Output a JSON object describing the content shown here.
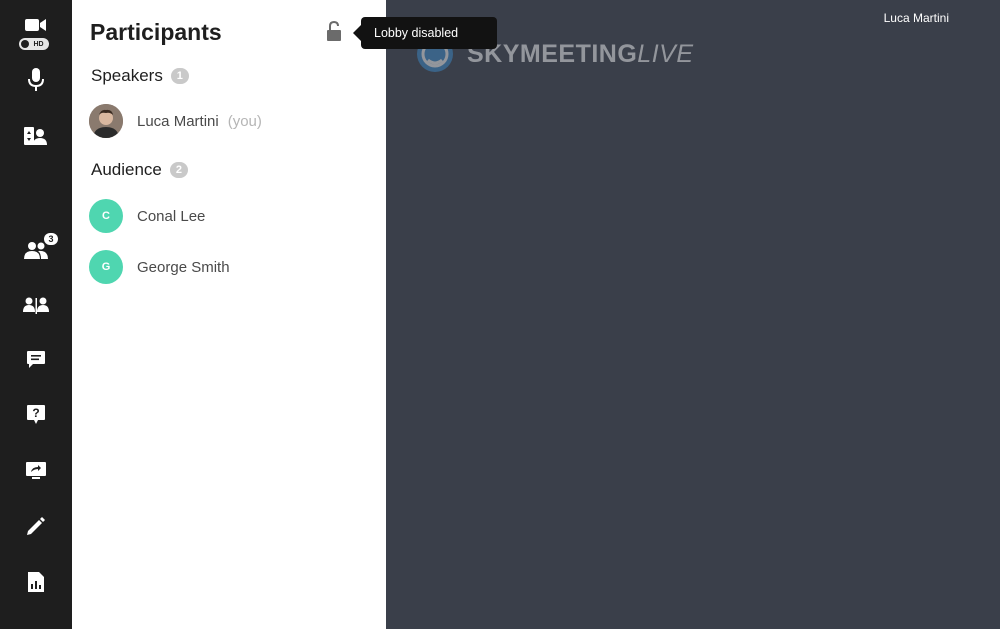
{
  "toolbar": {
    "hd_label": "HD",
    "participants_count": "3",
    "buttons": [
      "camera-icon",
      "microphone-icon",
      "switch-view-icon",
      "participants-icon",
      "breakout-icon",
      "chat-icon",
      "question-icon",
      "screen-share-icon",
      "whiteboard-icon",
      "poll-icon"
    ]
  },
  "panel": {
    "title": "Participants",
    "sections": {
      "speakers": {
        "label": "Speakers",
        "count": "1"
      },
      "audience": {
        "label": "Audience",
        "count": "2"
      }
    },
    "speakers": [
      {
        "name": "Luca Martini",
        "suffix": "(you)"
      }
    ],
    "audience": [
      {
        "initial": "C",
        "name": "Conal Lee"
      },
      {
        "initial": "G",
        "name": "George Smith"
      }
    ]
  },
  "tooltip": {
    "text": "Lobby disabled"
  },
  "stage": {
    "user_name": "Luca Martini",
    "logo_bold": "SKYMEETING",
    "logo_light": "LIVE"
  },
  "colors": {
    "toolbar_bg": "#1e1e1e",
    "stage_bg": "#3a3f4a",
    "avatar_accent": "#4fd6b0",
    "tooltip_bg": "#121212"
  }
}
